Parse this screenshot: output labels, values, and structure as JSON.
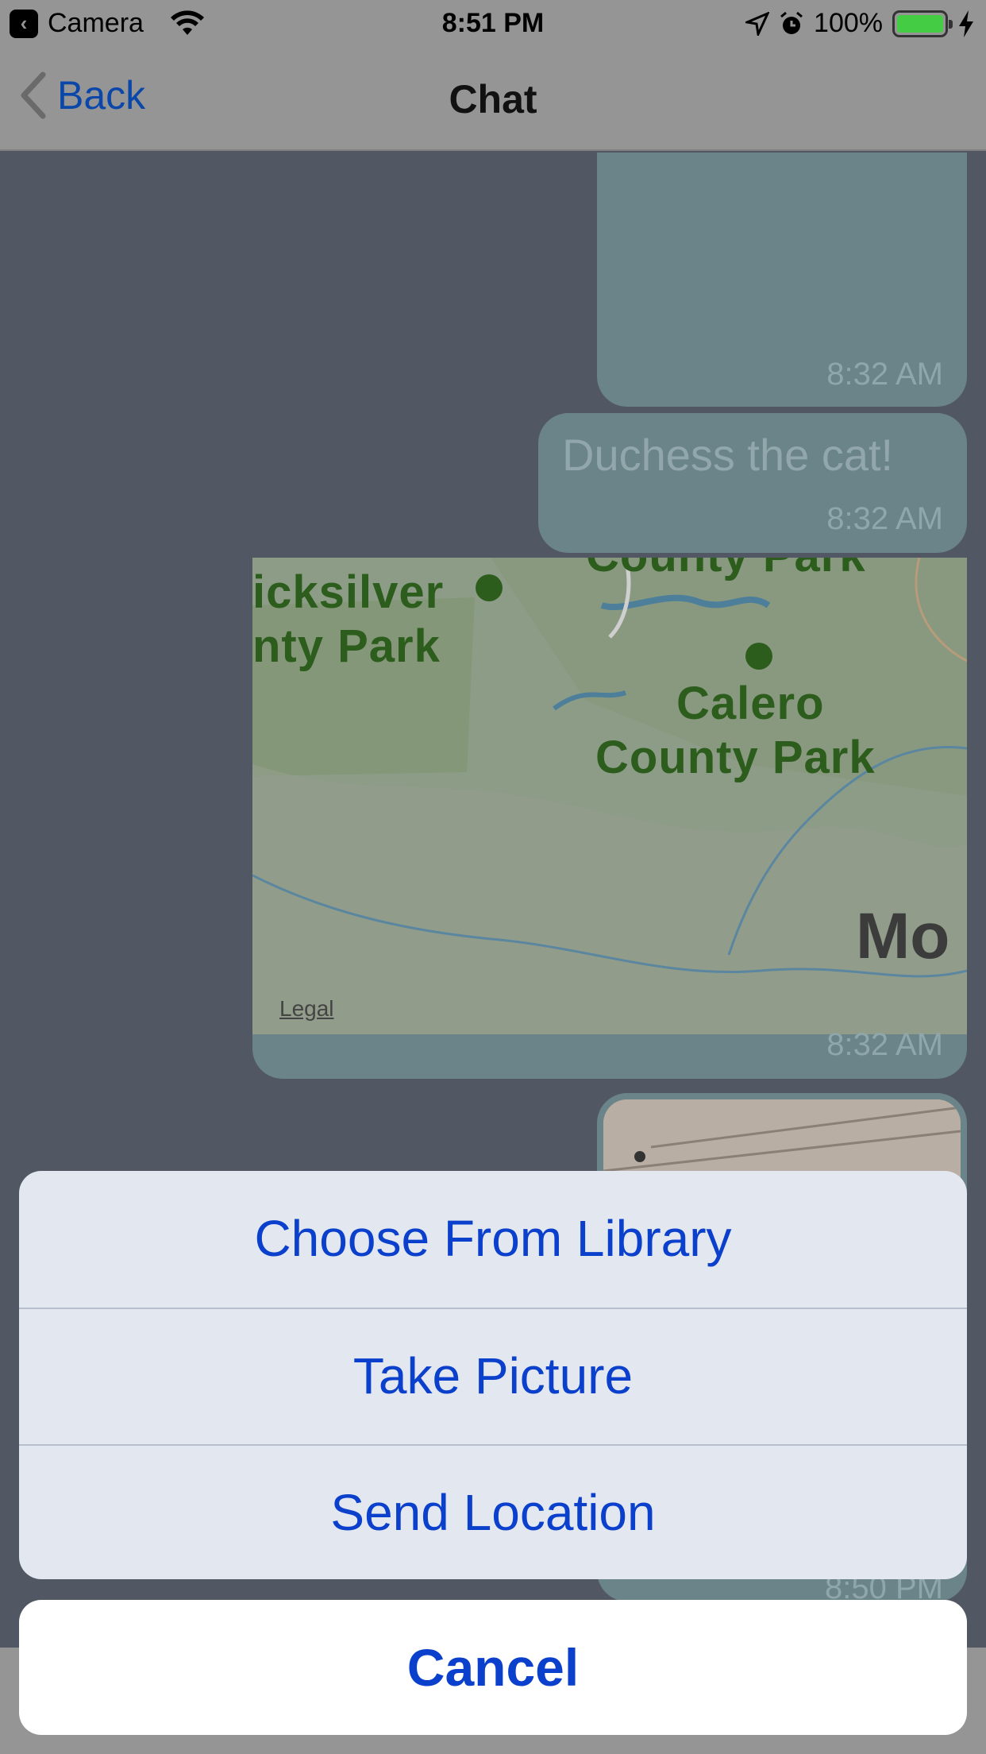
{
  "status_bar": {
    "back_app_label": "Camera",
    "time": "8:51 PM",
    "battery_percent": "100%"
  },
  "nav": {
    "back_label": "Back",
    "title": "Chat"
  },
  "messages": [
    {
      "time": "8:32 AM"
    },
    {
      "text": "Duchess the cat!",
      "time": "8:32 AM"
    },
    {
      "map": {
        "labels": [
          "icksilver",
          "nty Park",
          "County Park",
          "Calero",
          "County Park",
          "Mo"
        ],
        "legal": "Legal"
      },
      "time": "8:32 AM"
    },
    {
      "time": "8:50 PM"
    }
  ],
  "action_sheet": {
    "items": [
      "Choose From Library",
      "Take Picture",
      "Send Location"
    ],
    "cancel": "Cancel"
  },
  "colors": {
    "accent": "#0b40cc",
    "bubble": "#6b8489",
    "background": "#515864"
  }
}
